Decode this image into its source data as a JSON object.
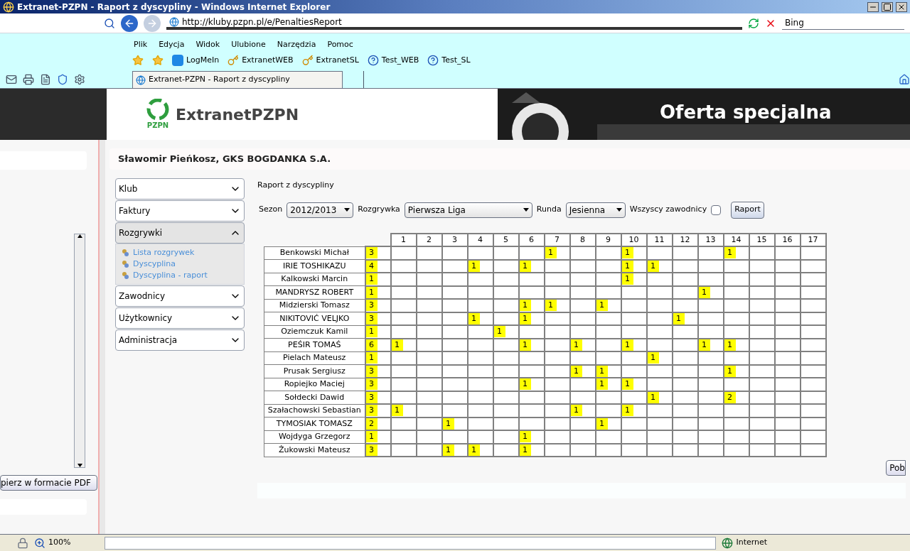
{
  "window": {
    "title": "Extranet-PZPN - Raport z dyscypliny - Windows Internet Explorer"
  },
  "address_bar": {
    "url": "http://kluby.pzpn.pl/e/PenaltiesReport",
    "search": "Bing"
  },
  "menu": [
    "Plik",
    "Edycja",
    "Widok",
    "Ulubione",
    "Narzędzia",
    "Pomoc"
  ],
  "favorites": [
    {
      "label": "LogMeIn",
      "kind": "logmein"
    },
    {
      "label": "ExtranetWEB",
      "kind": "key"
    },
    {
      "label": "ExtranetSL",
      "kind": "key"
    },
    {
      "label": "Test_WEB",
      "kind": "help"
    },
    {
      "label": "Test_SL",
      "kind": "help"
    }
  ],
  "tab": {
    "label": "Extranet-PZPN - Raport z dyscypliny"
  },
  "banner": {
    "logo_text": "ExtranetPZPN",
    "logo_caption": "PZPN",
    "ad_text": "Oferta specjalna"
  },
  "left_panel": {
    "button": "pierz w formacie PDF"
  },
  "header": {
    "user": "Sławomir Pieńkosz, GKS BOGDANKA S.A."
  },
  "nav": [
    {
      "label": "Klub",
      "expanded": false
    },
    {
      "label": "Faktury",
      "expanded": false
    },
    {
      "label": "Rozgrywki",
      "expanded": true,
      "children": [
        "Lista rozgrywek",
        "Dyscyplina",
        "Dyscyplina - raport"
      ]
    },
    {
      "label": "Zawodnicy",
      "expanded": false
    },
    {
      "label": "Użytkownicy",
      "expanded": false
    },
    {
      "label": "Administracja",
      "expanded": false
    }
  ],
  "report": {
    "title": "Raport z dyscypliny",
    "filters": {
      "season_label": "Sezon",
      "season": "2012/2013",
      "competition_label": "Rozgrywka",
      "competition": "Pierwsza Liga",
      "round_label": "Runda",
      "round": "Jesienna",
      "all_players_label": "Wszyscy zawodnicy",
      "all_players": false,
      "button": "Raport"
    },
    "columns": [
      "1",
      "2",
      "3",
      "4",
      "5",
      "6",
      "7",
      "8",
      "9",
      "10",
      "11",
      "12",
      "13",
      "14",
      "15",
      "16",
      "17"
    ],
    "rows": [
      {
        "name": "Benkowski Michał",
        "total": "3",
        "cells": [
          null,
          null,
          null,
          null,
          null,
          null,
          "1",
          null,
          null,
          "1",
          null,
          null,
          null,
          "1",
          null,
          null,
          null
        ]
      },
      {
        "name": "IRIE TOSHIKAZU",
        "total": "4",
        "cells": [
          null,
          null,
          null,
          "1",
          null,
          "1",
          null,
          null,
          null,
          "1",
          "1",
          null,
          null,
          null,
          null,
          null,
          null
        ]
      },
      {
        "name": "Kalkowski Marcin",
        "total": "1",
        "cells": [
          null,
          null,
          null,
          null,
          null,
          null,
          null,
          null,
          null,
          "1",
          null,
          null,
          null,
          null,
          null,
          null,
          null
        ]
      },
      {
        "name": "MANDRYSZ ROBERT",
        "total": "1",
        "cells": [
          null,
          null,
          null,
          null,
          null,
          null,
          null,
          null,
          null,
          null,
          null,
          null,
          "1",
          null,
          null,
          null,
          null
        ]
      },
      {
        "name": "Midzierski Tomasz",
        "total": "3",
        "cells": [
          null,
          null,
          null,
          null,
          null,
          "1",
          "1",
          null,
          "1",
          null,
          null,
          null,
          null,
          null,
          null,
          null,
          null
        ]
      },
      {
        "name": "NIKITOVIĆ VELJKO",
        "total": "3",
        "cells": [
          null,
          null,
          null,
          "1",
          null,
          "1",
          null,
          null,
          null,
          null,
          null,
          "1",
          null,
          null,
          null,
          null,
          null
        ]
      },
      {
        "name": "Oziemczuk Kamil",
        "total": "1",
        "cells": [
          null,
          null,
          null,
          null,
          "1",
          null,
          null,
          null,
          null,
          null,
          null,
          null,
          null,
          null,
          null,
          null,
          null
        ]
      },
      {
        "name": "PEŚIR TOMAŚ",
        "total": "6",
        "cells": [
          "1",
          null,
          null,
          null,
          null,
          "1",
          null,
          "1",
          null,
          "1",
          null,
          null,
          "1",
          "1",
          null,
          null,
          null
        ]
      },
      {
        "name": "Pielach Mateusz",
        "total": "1",
        "cells": [
          null,
          null,
          null,
          null,
          null,
          null,
          null,
          null,
          null,
          null,
          "1",
          null,
          null,
          null,
          null,
          null,
          null
        ]
      },
      {
        "name": "Prusak Sergiusz",
        "total": "3",
        "cells": [
          null,
          null,
          null,
          null,
          null,
          null,
          null,
          "1",
          "1",
          null,
          null,
          null,
          null,
          "1",
          null,
          null,
          null
        ]
      },
      {
        "name": "Ropiejko Maciej",
        "total": "3",
        "cells": [
          null,
          null,
          null,
          null,
          null,
          "1",
          null,
          null,
          "1",
          "1",
          null,
          null,
          null,
          null,
          null,
          null,
          null
        ]
      },
      {
        "name": "Sołdecki Dawid",
        "total": "3",
        "cells": [
          null,
          null,
          null,
          null,
          null,
          null,
          null,
          null,
          null,
          null,
          "1",
          null,
          null,
          "2",
          null,
          null,
          null
        ]
      },
      {
        "name": "Szałachowski Sebastian",
        "total": "3",
        "cells": [
          "1",
          null,
          null,
          null,
          null,
          null,
          null,
          "1",
          null,
          "1",
          null,
          null,
          null,
          null,
          null,
          null,
          null
        ]
      },
      {
        "name": "TYMOSIAK TOMASZ",
        "total": "2",
        "cells": [
          null,
          null,
          "1",
          null,
          null,
          null,
          null,
          null,
          "1",
          null,
          null,
          null,
          null,
          null,
          null,
          null,
          null
        ]
      },
      {
        "name": "Wojdyga Grzegorz",
        "total": "1",
        "cells": [
          null,
          null,
          null,
          null,
          null,
          "1",
          null,
          null,
          null,
          null,
          null,
          null,
          null,
          null,
          null,
          null,
          null
        ]
      },
      {
        "name": "Żukowski Mateusz",
        "total": "3",
        "cells": [
          null,
          null,
          "1",
          "1",
          null,
          "1",
          null,
          null,
          null,
          null,
          null,
          null,
          null,
          null,
          null,
          null,
          null
        ]
      }
    ],
    "download_button": "Pob"
  },
  "status_bar": {
    "zoom": "100%",
    "zone": "Internet"
  }
}
